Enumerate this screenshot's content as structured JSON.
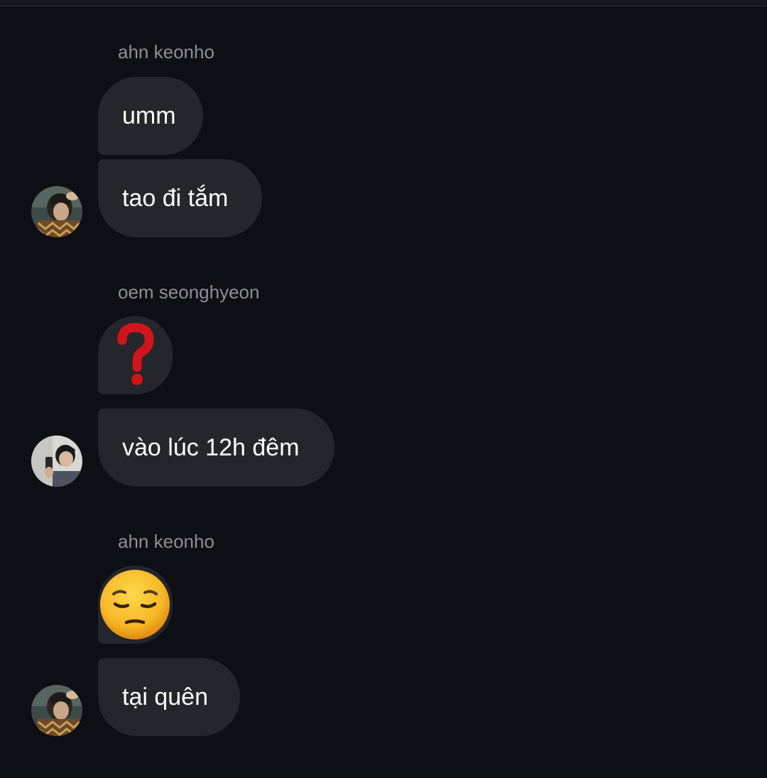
{
  "conversation": [
    {
      "sender": "ahn keonho",
      "messages": [
        "umm",
        "tao đi tắm"
      ]
    },
    {
      "sender": "oem seonghyeon",
      "messages": [
        "❓",
        "vào lúc 12h đêm"
      ]
    },
    {
      "sender": "ahn keonho",
      "messages": [
        "😔",
        "tại quên"
      ]
    }
  ],
  "icons": {
    "question": "question-mark-emoji",
    "pensive": "pensive-face-emoji"
  },
  "colors": {
    "background": "#0e0f14",
    "bubble": "#25262b",
    "sender_name": "#8e8f96",
    "message_text": "#ffffff",
    "question_red": "#d0141b",
    "emoji_yellow": "#f6b828"
  }
}
